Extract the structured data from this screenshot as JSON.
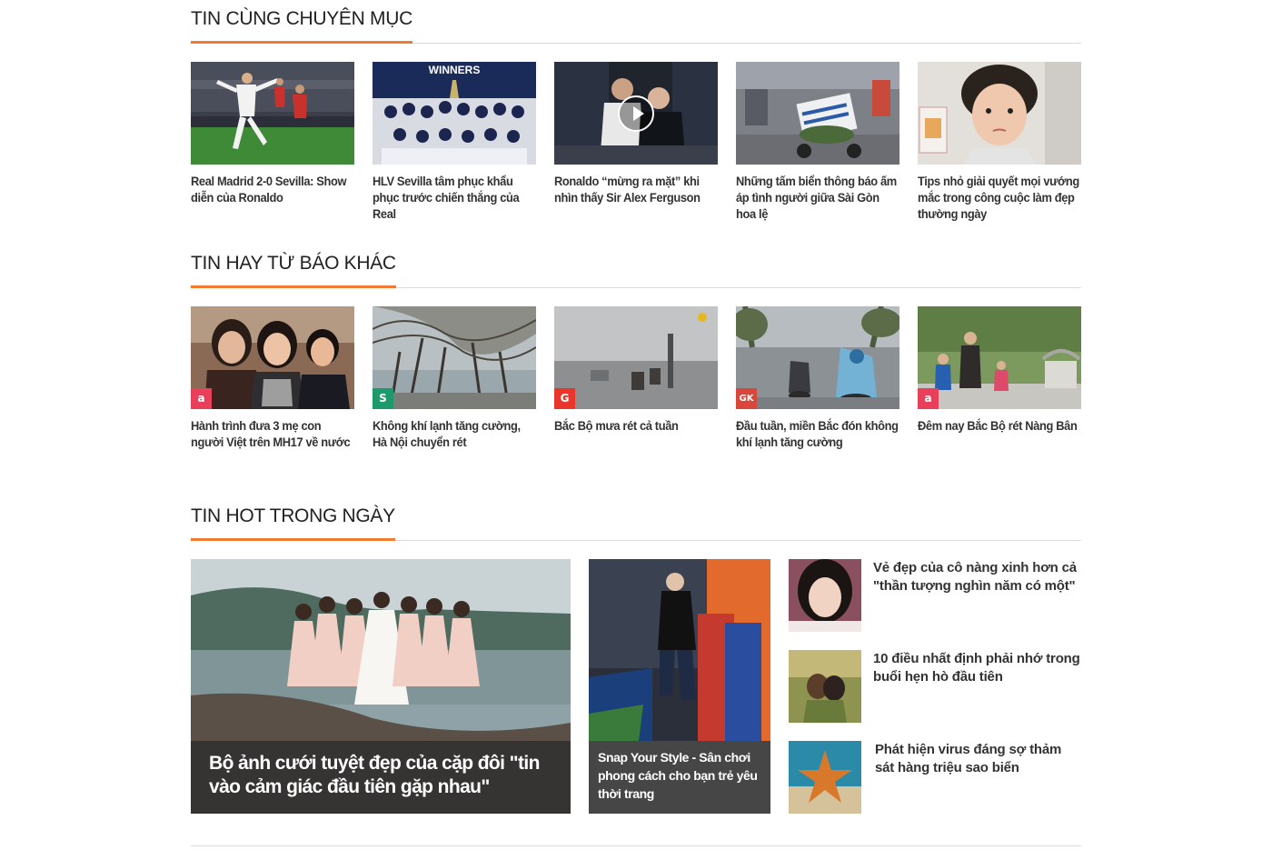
{
  "sections": {
    "same_category": {
      "title": "TIN CÙNG CHUYÊN MỤC",
      "items": [
        {
          "title": "Real Madrid 2-0 Sevilla: Show diễn của Ronaldo"
        },
        {
          "title": "HLV Sevilla tâm phục khẩu phục trước chiến thắng của Real",
          "thumb_text": "WINNERS"
        },
        {
          "title": "Ronaldo “mừng ra mặt” khi nhìn thấy Sir Alex Ferguson",
          "has_video": true
        },
        {
          "title": "Những tấm biển thông báo ấm áp tình người giữa Sài Gòn hoa lệ"
        },
        {
          "title": "Tips nhỏ giải quyết mọi vướng mắc trong công cuộc làm đẹp thường ngày"
        }
      ]
    },
    "other_papers": {
      "title": "TIN HAY TỪ BÁO KHÁC",
      "items": [
        {
          "title": "Hành trình đưa 3 mẹ con người Việt trên MH17 về nước",
          "badge": "a",
          "badge_color": "#e8405a"
        },
        {
          "title": "Không khí lạnh tăng cường, Hà Nội chuyển rét",
          "badge": "S",
          "badge_color": "#1d9a6c"
        },
        {
          "title": "Bắc Bộ mưa rét cả tuần",
          "badge": "G",
          "badge_color": "#e8362d"
        },
        {
          "title": "Đầu tuần, miền Bắc đón không khí lạnh tăng cường",
          "badge": "GK",
          "badge_color": "#d9473a"
        },
        {
          "title": "Đêm nay Bắc Bộ rét Nàng Bân",
          "badge": "a",
          "badge_color": "#e8405a"
        }
      ]
    },
    "hot_today": {
      "title": "TIN HOT TRONG NGÀY",
      "featured": {
        "title": "Bộ ảnh cưới tuyệt đẹp của cặp đôi \"tin vào cảm giác đầu tiên gặp nhau\""
      },
      "secondary": {
        "title": "Snap Your Style - Sân chơi phong cách cho bạn trẻ yêu thời trang"
      },
      "list": [
        {
          "title": "Vẻ đẹp của cô nàng xinh hơn cả \"thần tượng nghìn năm có một\""
        },
        {
          "title": "10 điều nhất định phải nhớ trong buổi hẹn hò đầu tiên"
        },
        {
          "title": "Phát hiện virus đáng sợ thảm sát hàng triệu sao biển"
        }
      ]
    }
  },
  "colors": {
    "accent": "#f07a30",
    "divider": "#dcdcdc",
    "text": "#333333"
  }
}
